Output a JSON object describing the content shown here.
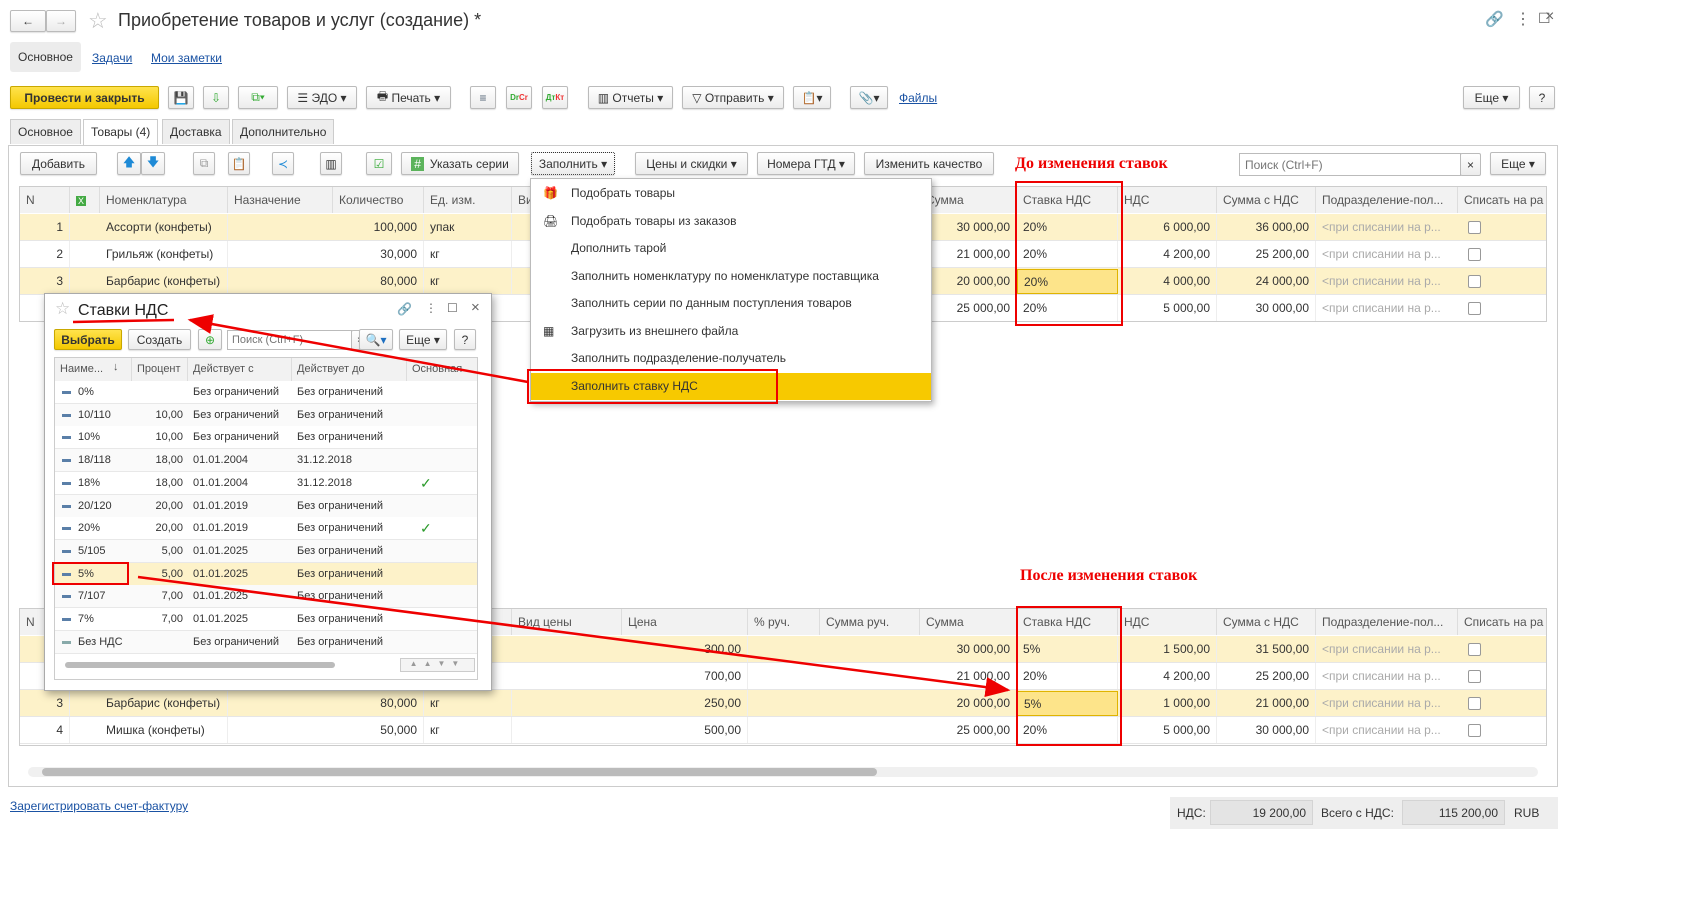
{
  "window": {
    "title": "Приобретение товаров и услуг (создание) *"
  },
  "nav_tabs": [
    "Основное",
    "Задачи",
    "Мои заметки"
  ],
  "toolbar": {
    "post_close": "Провести и закрыть",
    "edo": "ЭДО",
    "print": "Печать",
    "reports": "Отчеты",
    "send": "Отправить",
    "files": "Файлы",
    "more": "Еще",
    "help": "?"
  },
  "form_tabs": [
    "Основное",
    "Товары (4)",
    "Доставка",
    "Дополнительно"
  ],
  "goods_toolbar": {
    "add": "Добавить",
    "series": "Указать серии",
    "fill": "Заполнить",
    "prices": "Цены и скидки",
    "gtd": "Номера ГТД",
    "quality": "Изменить качество",
    "search_placeholder": "Поиск (Ctrl+F)",
    "clear": "×",
    "more": "Еще"
  },
  "columns": [
    "N",
    "",
    "Номенклатура",
    "Назначение",
    "Количество",
    "Ед. изм.",
    "Вид цены",
    "Цена",
    "% руч.",
    "Сумма руч.",
    "Сумма",
    "Ставка НДС",
    "НДС",
    "Сумма с НДС",
    "Подразделение-пол...",
    "Списать на ра"
  ],
  "dept_placeholder": "<при списании на р...",
  "table_before": [
    {
      "n": "1",
      "name": "Ассорти (конфеты)",
      "purpose": "",
      "qty": "100,000",
      "unit": "упак",
      "price_type": "",
      "price": "",
      "pct": "",
      "sum_manual": "",
      "sum": "30 000,00",
      "rate": "20%",
      "vat": "6 000,00",
      "total": "36 000,00"
    },
    {
      "n": "2",
      "name": "Грильяж (конфеты)",
      "purpose": "",
      "qty": "30,000",
      "unit": "кг",
      "price_type": "",
      "price": "",
      "pct": "",
      "sum_manual": "",
      "sum": "21 000,00",
      "rate": "20%",
      "vat": "4 200,00",
      "total": "25 200,00"
    },
    {
      "n": "3",
      "name": "Барбарис (конфеты)",
      "purpose": "",
      "qty": "80,000",
      "unit": "кг",
      "price_type": "",
      "price": "",
      "pct": "",
      "sum_manual": "",
      "sum": "20 000,00",
      "rate": "20%",
      "vat": "4 000,00",
      "total": "24 000,00"
    },
    {
      "n": "",
      "name": "",
      "purpose": "",
      "qty": "",
      "unit": "",
      "price_type": "",
      "price": "",
      "pct": "",
      "sum_manual": "",
      "sum": "25 000,00",
      "rate": "20%",
      "vat": "5 000,00",
      "total": "30 000,00"
    }
  ],
  "table_after": [
    {
      "n": "",
      "name": "",
      "purpose": "",
      "qty": "",
      "unit": "",
      "price_type": "",
      "price": "300,00",
      "pct": "",
      "sum_manual": "",
      "sum": "30 000,00",
      "rate": "5%",
      "vat": "1 500,00",
      "total": "31 500,00"
    },
    {
      "n": "",
      "name": "",
      "purpose": "",
      "qty": "",
      "unit": "",
      "price_type": "",
      "price": "700,00",
      "pct": "",
      "sum_manual": "",
      "sum": "21 000,00",
      "rate": "20%",
      "vat": "4 200,00",
      "total": "25 200,00"
    },
    {
      "n": "3",
      "name": "Барбарис (конфеты)",
      "purpose": "",
      "qty": "80,000",
      "unit": "кг",
      "price_type": "",
      "price": "250,00",
      "pct": "",
      "sum_manual": "",
      "sum": "20 000,00",
      "rate": "5%",
      "vat": "1 000,00",
      "total": "21 000,00"
    },
    {
      "n": "4",
      "name": "Мишка (конфеты)",
      "purpose": "",
      "qty": "50,000",
      "unit": "кг",
      "price_type": "",
      "price": "500,00",
      "pct": "",
      "sum_manual": "",
      "sum": "25 000,00",
      "rate": "20%",
      "vat": "5 000,00",
      "total": "30 000,00"
    }
  ],
  "fill_menu": [
    "Подобрать товары",
    "Подобрать товары из заказов",
    "Дополнить тарой",
    "Заполнить номенклатуру по номенклатуре поставщика",
    "Заполнить серии по данным поступления товаров",
    "Загрузить из внешнего файла",
    "Заполнить подразделение-получатель",
    "Заполнить ставку НДС"
  ],
  "vat_popup": {
    "title": "Ставки НДС",
    "select": "Выбрать",
    "create": "Создать",
    "search_placeholder": "Поиск (Ctrl+F)",
    "more": "Еще",
    "help": "?",
    "columns": [
      "Наиме...",
      "Процент",
      "Действует с",
      "Действует до",
      "Основная"
    ],
    "rows": [
      {
        "name": "0%",
        "pct": "",
        "from": "Без ограничений",
        "to": "Без ограничений",
        "main": false
      },
      {
        "name": "10/110",
        "pct": "10,00",
        "from": "Без ограничений",
        "to": "Без ограничений",
        "main": false
      },
      {
        "name": "10%",
        "pct": "10,00",
        "from": "Без ограничений",
        "to": "Без ограничений",
        "main": false
      },
      {
        "name": "18/118",
        "pct": "18,00",
        "from": "01.01.2004",
        "to": "31.12.2018",
        "main": false
      },
      {
        "name": "18%",
        "pct": "18,00",
        "from": "01.01.2004",
        "to": "31.12.2018",
        "main": true
      },
      {
        "name": "20/120",
        "pct": "20,00",
        "from": "01.01.2019",
        "to": "Без ограничений",
        "main": false
      },
      {
        "name": "20%",
        "pct": "20,00",
        "from": "01.01.2019",
        "to": "Без ограничений",
        "main": true
      },
      {
        "name": "5/105",
        "pct": "5,00",
        "from": "01.01.2025",
        "to": "Без ограничений",
        "main": false
      },
      {
        "name": "5%",
        "pct": "5,00",
        "from": "01.01.2025",
        "to": "Без ограничений",
        "main": false
      },
      {
        "name": "7/107",
        "pct": "7,00",
        "from": "01.01.2025",
        "to": "Без ограничений",
        "main": false
      },
      {
        "name": "7%",
        "pct": "7,00",
        "from": "01.01.2025",
        "to": "Без ограничений",
        "main": false
      },
      {
        "name": "Без НДС",
        "pct": "",
        "from": "Без ограничений",
        "to": "Без ограничений",
        "main": false
      }
    ]
  },
  "annotations": {
    "before": "До изменения ставок",
    "after": "После изменения ставок"
  },
  "footer": {
    "invoice_link": "Зарегистрировать счет-фактуру",
    "vat_label": "НДС:",
    "vat_value": "19 200,00",
    "total_label": "Всего с НДС:",
    "total_value": "115 200,00",
    "currency": "RUB"
  },
  "colors": {
    "accent_yellow": "#f4c800",
    "row_highlight": "#fdf2c9",
    "annotation_red": "#e00000",
    "link": "#1a52a3"
  }
}
